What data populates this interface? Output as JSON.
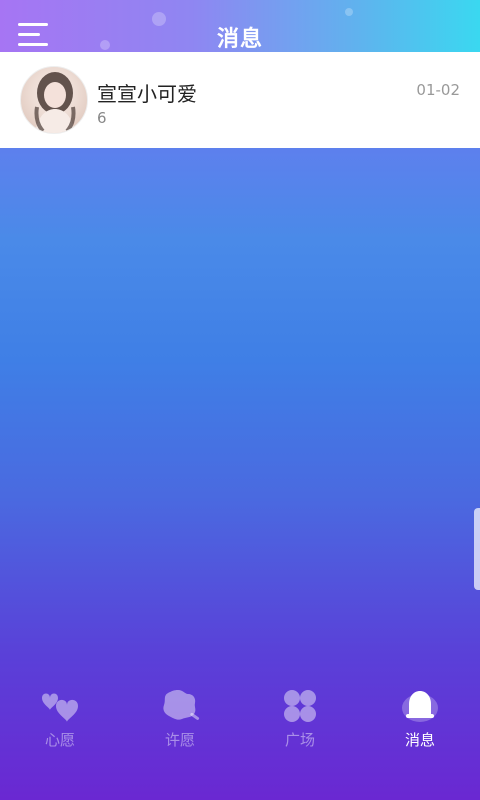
{
  "header": {
    "title": "消息"
  },
  "messages": [
    {
      "name": "宣宣小可爱",
      "preview": "6",
      "date": "01-02"
    }
  ],
  "tabs": [
    {
      "label": "心愿",
      "icon": "hearts-icon",
      "active": false
    },
    {
      "label": "许愿",
      "icon": "wish-flower-icon",
      "active": false
    },
    {
      "label": "广场",
      "icon": "four-leaf-grid-icon",
      "active": false
    },
    {
      "label": "消息",
      "icon": "bell-icon",
      "active": true
    }
  ],
  "colors": {
    "accent": "#8f86f2",
    "header_end": "#3ad8f0",
    "bg_bottom": "#6a28d2"
  }
}
